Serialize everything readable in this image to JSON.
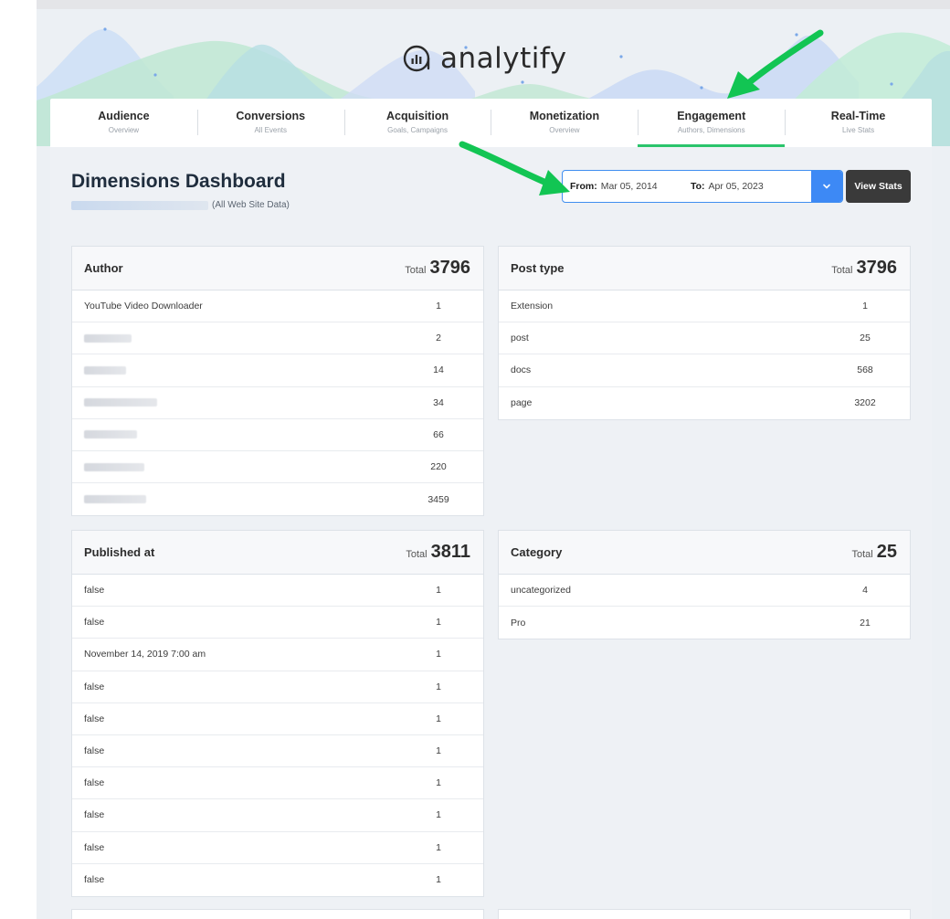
{
  "brand": {
    "name": "analytify"
  },
  "nav": [
    {
      "label": "Audience",
      "sub": "Overview",
      "active": false
    },
    {
      "label": "Conversions",
      "sub": "All Events",
      "active": false
    },
    {
      "label": "Acquisition",
      "sub": "Goals, Campaigns",
      "active": false
    },
    {
      "label": "Monetization",
      "sub": "Overview",
      "active": false
    },
    {
      "label": "Engagement",
      "sub": "Authors, Dimensions",
      "active": true
    },
    {
      "label": "Real-Time",
      "sub": "Live Stats",
      "active": false
    }
  ],
  "page": {
    "title": "Dimensions Dashboard",
    "site_suffix": "(All Web Site Data)"
  },
  "date_range": {
    "from_label": "From:",
    "from_value": "Mar 05, 2014",
    "to_label": "To:",
    "to_value": "Apr 05, 2023",
    "view_button": "View Stats"
  },
  "total_label": "Total",
  "cards": {
    "author": {
      "title": "Author",
      "total": "3796",
      "rows": [
        {
          "name": "YouTube Video Downloader",
          "value": "1"
        },
        {
          "name": "",
          "value": "2"
        },
        {
          "name": "",
          "value": "14"
        },
        {
          "name": "",
          "value": "34"
        },
        {
          "name": "",
          "value": "66"
        },
        {
          "name": "",
          "value": "220"
        },
        {
          "name": "",
          "value": "3459"
        }
      ]
    },
    "post_type": {
      "title": "Post type",
      "total": "3796",
      "rows": [
        {
          "name": "Extension",
          "value": "1"
        },
        {
          "name": "post",
          "value": "25"
        },
        {
          "name": "docs",
          "value": "568"
        },
        {
          "name": "page",
          "value": "3202"
        }
      ]
    },
    "published_at": {
      "title": "Published at",
      "total": "3811",
      "rows": [
        {
          "name": "false",
          "value": "1"
        },
        {
          "name": "false",
          "value": "1"
        },
        {
          "name": "November 14, 2019 7:00 am",
          "value": "1"
        },
        {
          "name": "false",
          "value": "1"
        },
        {
          "name": "false",
          "value": "1"
        },
        {
          "name": "false",
          "value": "1"
        },
        {
          "name": "false",
          "value": "1"
        },
        {
          "name": "false",
          "value": "1"
        },
        {
          "name": "false",
          "value": "1"
        },
        {
          "name": "false",
          "value": "1"
        }
      ]
    },
    "category": {
      "title": "Category",
      "total": "25",
      "rows": [
        {
          "name": "uncategorized",
          "value": "4"
        },
        {
          "name": "Pro",
          "value": "21"
        }
      ]
    }
  },
  "colors": {
    "accent_green": "#2bc46b",
    "accent_blue": "#3d89f5",
    "button_dark": "#3a3a3a",
    "annotation_arrow": "#12c553"
  }
}
